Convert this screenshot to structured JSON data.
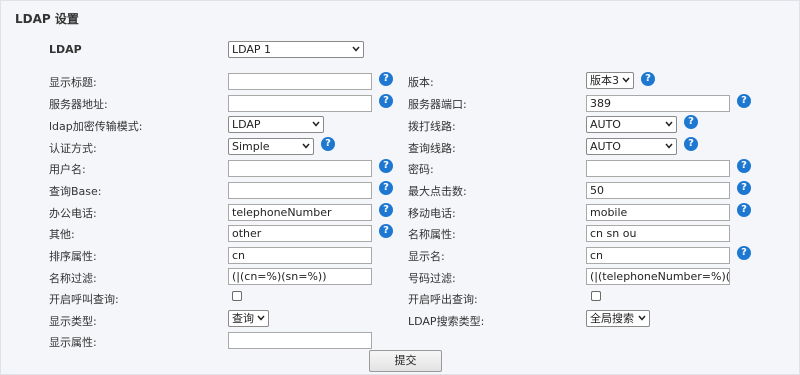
{
  "page": {
    "title": "LDAP 设置"
  },
  "ldap_select": {
    "label": "LDAP",
    "value": "LDAP 1"
  },
  "left_labels": {
    "display_title": "显示标题:",
    "server_address": "服务器地址:",
    "ldap_transport": "ldap加密传输模式:",
    "auth_method": "认证方式:",
    "username": "用户名:",
    "query_base": "查询Base:",
    "office_phone": "办公电话:",
    "other": "其他:",
    "sort_attr": "排序属性:",
    "name_filter": "名称过滤:",
    "enable_call_lookup": "开启呼叫查询:",
    "display_type": "显示类型:",
    "display_attr": "显示属性:"
  },
  "left_values": {
    "display_title": "",
    "server_address": "",
    "ldap_transport": "LDAP",
    "auth_method": "Simple",
    "username": "",
    "query_base": "",
    "office_phone": "telephoneNumber",
    "other": "other",
    "sort_attr": "cn",
    "name_filter": "(|(cn=%)(sn=%))",
    "enable_call_lookup": false,
    "display_type": "查询",
    "display_attr": ""
  },
  "right_labels": {
    "version": "版本:",
    "server_port": "服务器端口:",
    "dial_line": "拨打线路:",
    "query_line": "查询线路:",
    "password": "密码:",
    "max_hits": "最大点击数:",
    "mobile_phone": "移动电话:",
    "name_attr": "名称属性:",
    "display_name": "显示名:",
    "number_filter": "号码过滤:",
    "enable_callout_lookup": "开启呼出查询:",
    "ldap_search_type": "LDAP搜索类型:"
  },
  "right_values": {
    "version": "版本3",
    "server_port": "389",
    "dial_line": "AUTO",
    "query_line": "AUTO",
    "password": "",
    "max_hits": "50",
    "mobile_phone": "mobile",
    "name_attr": "cn sn ou",
    "display_name": "cn",
    "number_filter": "(|(telephoneNumber=%)(mob",
    "enable_callout_lookup": false,
    "ldap_search_type": "全局搜索"
  },
  "help_glyph": "?",
  "submit_label": "提交",
  "colors": {
    "help_icon": "#1e78d2",
    "panel_bg": "#f4f6f9"
  }
}
